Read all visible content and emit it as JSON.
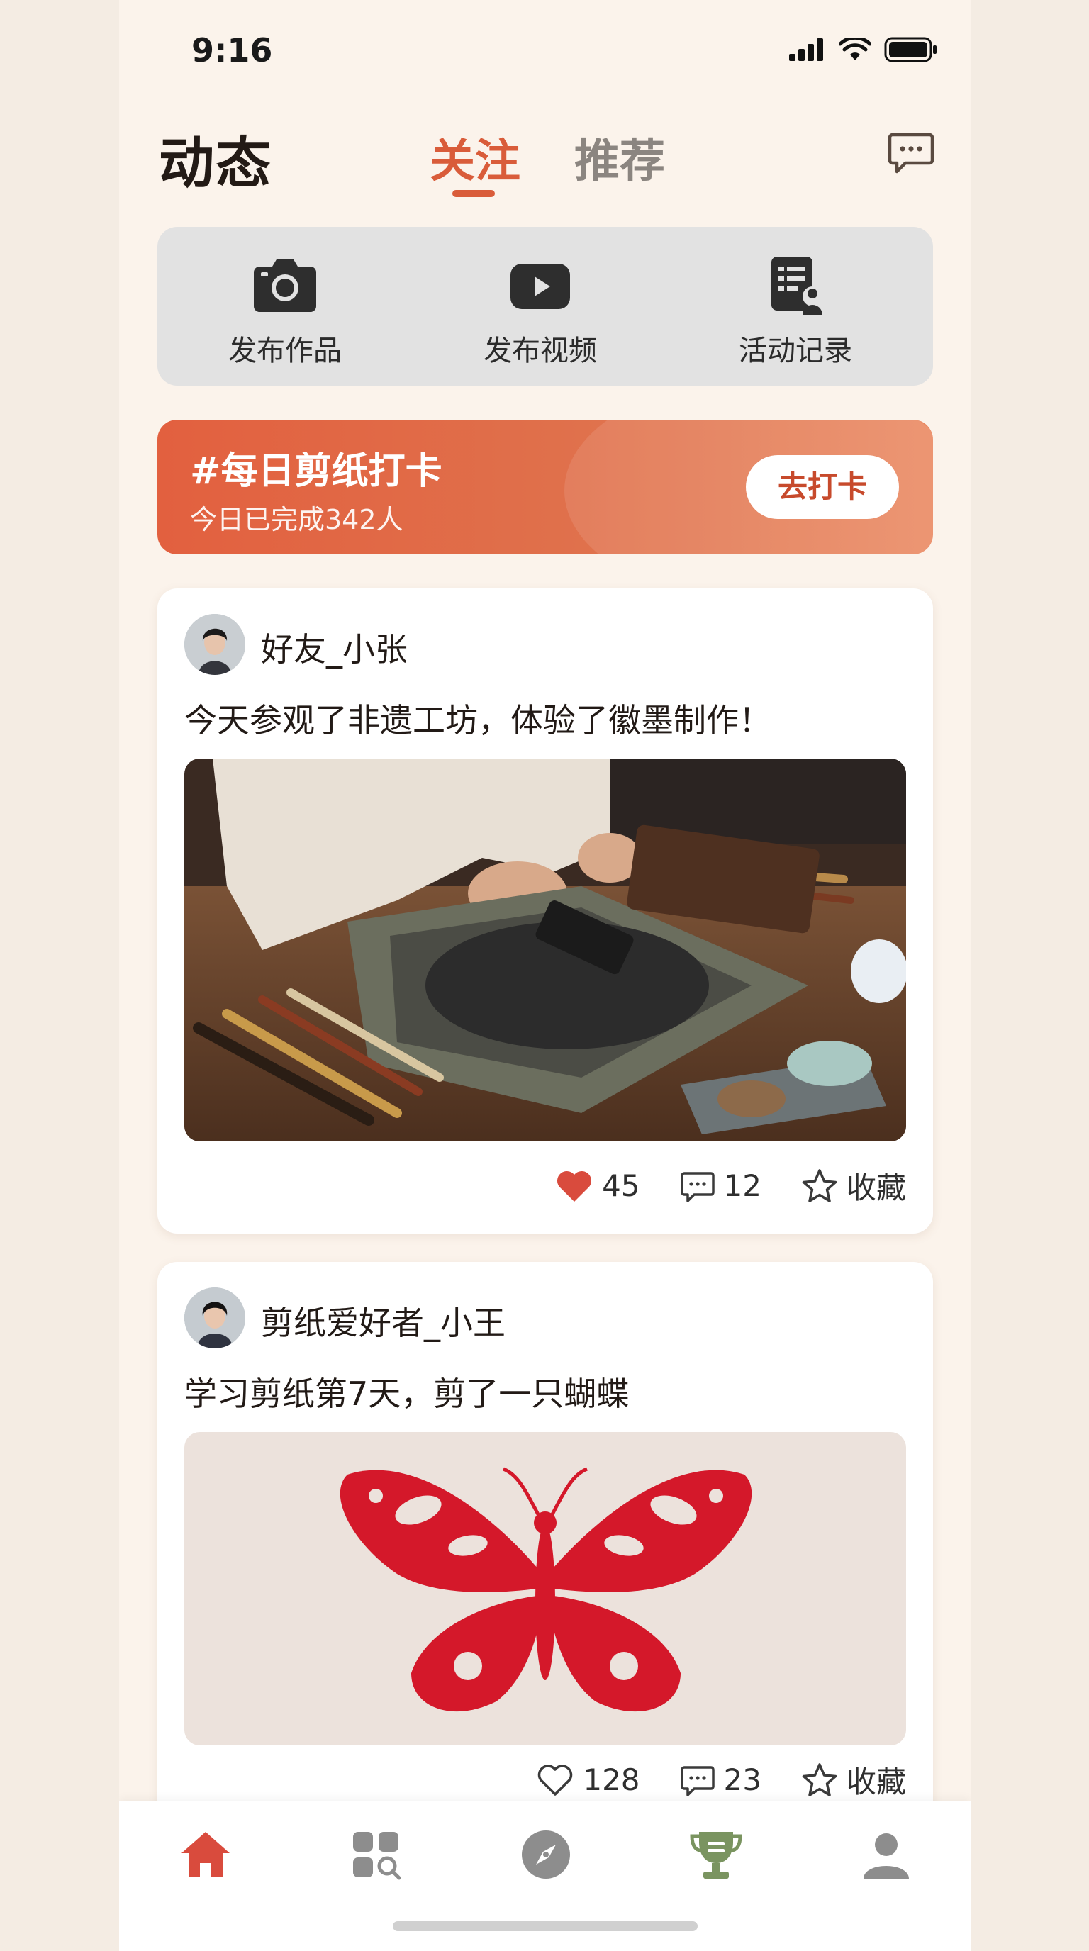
{
  "status": {
    "time": "9:16"
  },
  "header": {
    "title": "动态",
    "tabs": [
      {
        "label": "关注",
        "active": true
      },
      {
        "label": "推荐",
        "active": false
      }
    ],
    "message_icon": "chat-bubble-icon"
  },
  "quick_actions": [
    {
      "label": "发布作品",
      "icon": "camera-icon"
    },
    {
      "label": "发布视频",
      "icon": "play-video-icon"
    },
    {
      "label": "活动记录",
      "icon": "activity-record-icon"
    }
  ],
  "banner": {
    "title": "#每日剪纸打卡",
    "subtitle": "今日已完成342人",
    "button": "去打卡"
  },
  "posts": [
    {
      "author": "好友_小张",
      "text": "今天参观了非遗工坊，体验了徽墨制作！",
      "image": "ink-stick-making-photo",
      "likes": "45",
      "comments": "12",
      "favorite_label": "收藏",
      "liked": true
    },
    {
      "author": "剪纸爱好者_小王",
      "text": "学习剪纸第7天，剪了一只蝴蝶",
      "image": "red-paper-cut-butterfly-photo",
      "likes": "128",
      "comments": "23",
      "favorite_label": "收藏",
      "liked": false
    }
  ],
  "tabbar": [
    {
      "icon": "home-icon",
      "active": true
    },
    {
      "icon": "category-search-icon",
      "active": false
    },
    {
      "icon": "compass-icon",
      "active": false
    },
    {
      "icon": "trophy-icon",
      "active": false
    },
    {
      "icon": "profile-icon",
      "active": false
    }
  ],
  "colors": {
    "accent": "#d95c3a",
    "background": "#fbf3eb",
    "banner_start": "#e2603f",
    "trophy_green": "#7a9460"
  }
}
